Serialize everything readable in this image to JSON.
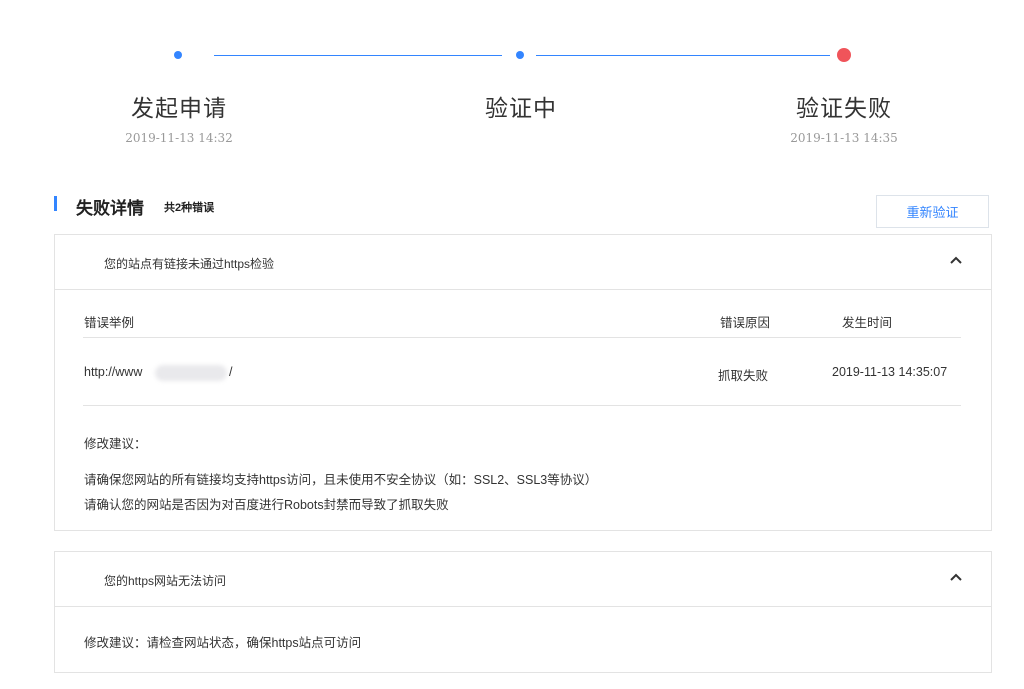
{
  "steps": [
    {
      "title": "发起申请",
      "time": "2019-11-13 14:32"
    },
    {
      "title": "验证中",
      "time": ""
    },
    {
      "title": "验证失败",
      "time": "2019-11-13 14:35"
    }
  ],
  "section": {
    "title": "失败详情",
    "count": "共2种错误",
    "retry_label": "重新验证"
  },
  "error1": {
    "title": "您的站点有链接未通过https检验",
    "columns": [
      "错误举例",
      "错误原因",
      "发生时间"
    ],
    "rows": [
      {
        "example_prefix": "http://www",
        "example_suffix": "/",
        "reason": "抓取失败",
        "time": "2019-11-13 14:35:07"
      }
    ],
    "advice_label": "修改建议：",
    "advice": [
      "请确保您网站的所有链接均支持https访问，且未使用不安全协议（如：SSL2、SSL3等协议）",
      "请确认您的网站是否因为对百度进行Robots封禁而导致了抓取失败"
    ]
  },
  "error2": {
    "title": "您的https网站无法访问",
    "advice": "修改建议：请检查网站状态，确保https站点可访问"
  },
  "colors": {
    "accent": "#3385ff",
    "error": "#f0545a"
  },
  "icons": {
    "collapse": "chevron-up-icon"
  }
}
